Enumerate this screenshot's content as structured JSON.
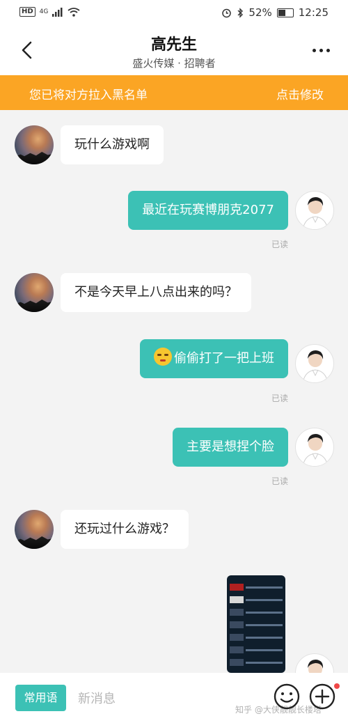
{
  "status_bar": {
    "hd": "HD",
    "network": "4G",
    "battery": "52%",
    "battery_level": 0.52,
    "time": "12:25"
  },
  "header": {
    "title": "高先生",
    "subtitle": "盛火传媒 · 招聘者"
  },
  "banner": {
    "text": "您已将对方拉入黑名单",
    "action": "点击修改",
    "color": "#fba524"
  },
  "messages": [
    {
      "from": "other",
      "text": "玩什么游戏啊"
    },
    {
      "from": "self",
      "text": "最近在玩赛博朋克2077",
      "status": "已读"
    },
    {
      "from": "other",
      "text": "不是今天早上八点出来的吗？"
    },
    {
      "from": "self",
      "text": "偷偷打了一把上班",
      "status": "已读",
      "emoji": "shushing-face"
    },
    {
      "from": "self",
      "text": "主要是想捏个脸",
      "status": "已读"
    },
    {
      "from": "other",
      "text": "还玩过什么游戏？"
    },
    {
      "from": "self",
      "type": "image",
      "image": "game-library-screenshot"
    }
  ],
  "image_message": {
    "rows": [
      "Bloodstained: Ritual",
      "Far Cry Primal",
      "Dragon's Dogma: Dar",
      "Assassin's Creed",
      "Street Fighter V",
      "Dishonored",
      "Subnautica"
    ]
  },
  "bottom_bar": {
    "quick_phrases": "常用语",
    "input_placeholder": "新消息",
    "watermark": "知乎 @大侠靓靓长楼塔"
  },
  "colors": {
    "accent": "#3cc1b5",
    "self_bubble": "#3cc1b5",
    "other_bubble": "#ffffff",
    "background": "#f3f3f3"
  }
}
